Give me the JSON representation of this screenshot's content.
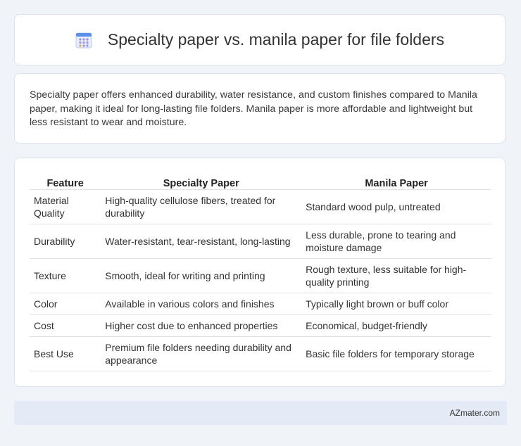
{
  "header": {
    "title": "Specialty paper vs. manila paper for file folders",
    "icon": "calendar-grid-icon"
  },
  "summary": {
    "text": "Specialty paper offers enhanced durability, water resistance, and custom finishes compared to Manila paper, making it ideal for long-lasting file folders. Manila paper is more affordable and lightweight but less resistant to wear and moisture."
  },
  "table": {
    "headers": [
      "Feature",
      "Specialty Paper",
      "Manila Paper"
    ],
    "rows": [
      [
        "Material Quality",
        "High-quality cellulose fibers, treated for durability",
        "Standard wood pulp, untreated"
      ],
      [
        "Durability",
        "Water-resistant, tear-resistant, long-lasting",
        "Less durable, prone to tearing and moisture damage"
      ],
      [
        "Texture",
        "Smooth, ideal for writing and printing",
        "Rough texture, less suitable for high-quality printing"
      ],
      [
        "Color",
        "Available in various colors and finishes",
        "Typically light brown or buff color"
      ],
      [
        "Cost",
        "Higher cost due to enhanced properties",
        "Economical, budget-friendly"
      ],
      [
        "Best Use",
        "Premium file folders needing durability and appearance",
        "Basic file folders for temporary storage"
      ]
    ]
  },
  "footer": {
    "site": "AZmater.com"
  },
  "colors": {
    "background": "#f0f3f8",
    "card": "#ffffff",
    "footer_bg": "#e5ebf6",
    "icon_blue": "#5b8fe8"
  }
}
